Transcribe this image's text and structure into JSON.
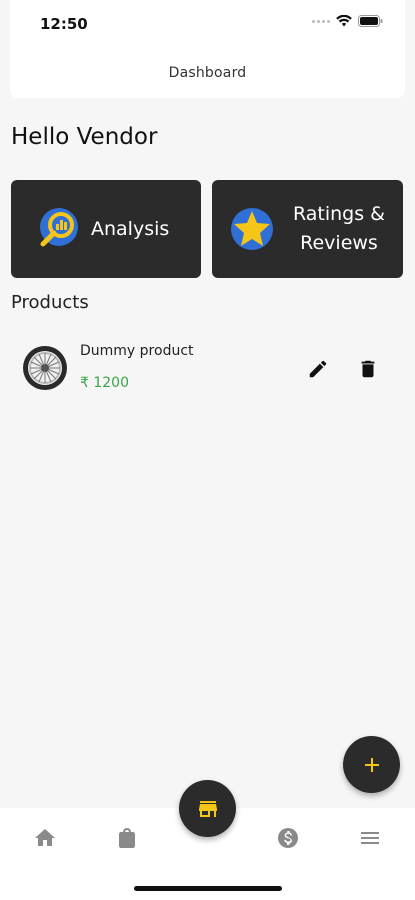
{
  "status_bar": {
    "time": "12:50"
  },
  "header": {
    "title": "Dashboard"
  },
  "greeting": "Hello Vendor",
  "cards": {
    "analysis": {
      "label": "Analysis",
      "icon": "analysis-magnifier-icon"
    },
    "ratings": {
      "label_line1": "Ratings &",
      "label_line2": "Reviews",
      "icon": "star-icon"
    }
  },
  "products": {
    "title": "Products",
    "items": [
      {
        "name": "Dummy product",
        "price": "₹ 1200",
        "thumb": "wheel-thumbnail"
      }
    ]
  },
  "fab": {
    "icon": "plus-icon"
  },
  "bottom_nav": {
    "items": [
      "home-icon",
      "shopping-bag-icon",
      "store-icon",
      "dollar-icon",
      "menu-icon"
    ]
  },
  "colors": {
    "card_bg": "#2b2b2b",
    "accent_yellow": "#f5c518",
    "price_green": "#3aa64b",
    "nav_icon": "#8a8a8a"
  }
}
